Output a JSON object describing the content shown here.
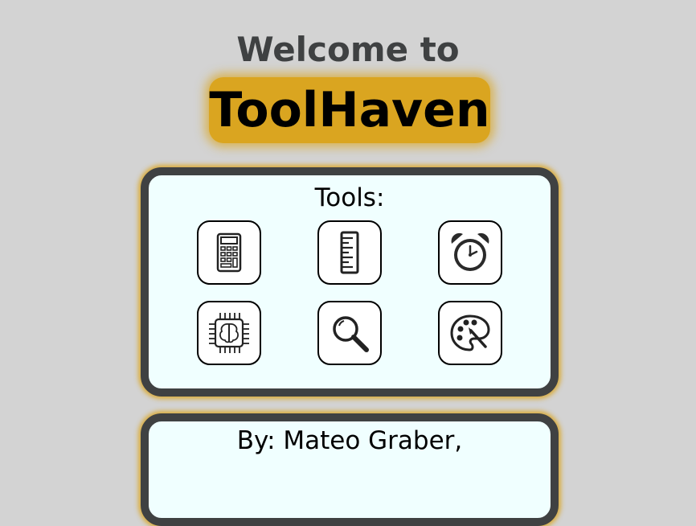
{
  "header": {
    "welcome": "Welcome to",
    "brand": "ToolHaven"
  },
  "tools_panel": {
    "title": "Tools:",
    "tools": [
      {
        "icon": "calculator-icon"
      },
      {
        "icon": "ruler-icon"
      },
      {
        "icon": "alarm-clock-icon"
      },
      {
        "icon": "ai-chip-brain-icon"
      },
      {
        "icon": "magnifier-icon"
      },
      {
        "icon": "paint-palette-icon"
      }
    ]
  },
  "author_panel": {
    "text": "By: Mateo Graber,"
  },
  "colors": {
    "background": "#d3d3d3",
    "accent": "#daa520",
    "panel_border": "#3f4142",
    "panel_fill": "#f0ffff"
  }
}
